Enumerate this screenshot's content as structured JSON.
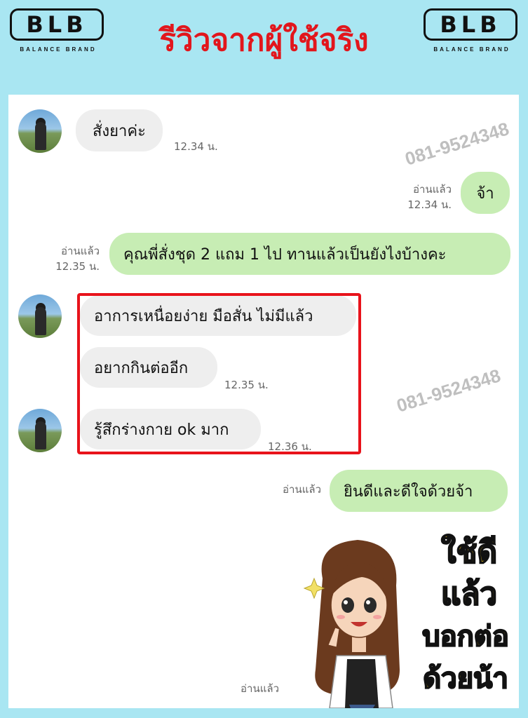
{
  "header": {
    "logo_text": "BLB",
    "logo_subtext": "BALANCE BRAND",
    "title": "รีวิวจากผู้ใช้จริง"
  },
  "watermark": "081-9524348",
  "messages": {
    "m1": {
      "text": "สั่งยาค่ะ",
      "time": "12.34 น."
    },
    "m2": {
      "text": "จ้า",
      "read": "อ่านแล้ว",
      "time": "12.34 น."
    },
    "m3": {
      "text": "คุณพี่สั่งชุด 2 แถม 1 ไป ทานแล้วเป็นยังไงบ้างคะ",
      "read": "อ่านแล้ว",
      "time": "12.35 น."
    },
    "m4": {
      "text": "อาการเหนื่อยง่าย มือสั่น ไม่มีแล้ว"
    },
    "m5": {
      "text": "อยากกินต่ออีก",
      "time": "12.35 น."
    },
    "m6": {
      "text": "รู้สึกร่างกาย ok มาก",
      "time": "12.36 น."
    },
    "m7": {
      "text": "ยินดีและดีใจด้วยจ้า",
      "read": "อ่านแล้ว"
    },
    "m8": {
      "read": "อ่านแล้ว"
    }
  },
  "sticker": {
    "lines": [
      "ใช้ดี",
      "แล้ว",
      "บอกต่อ",
      "ด้วยน้า"
    ]
  },
  "colors": {
    "background": "#a9e6f2",
    "title_red": "#e2161c",
    "bubble_green": "#c7edb4",
    "bubble_gray": "#eeeeee",
    "highlight_red": "#e8131b",
    "sticker_yellow": "#f2c51c"
  }
}
